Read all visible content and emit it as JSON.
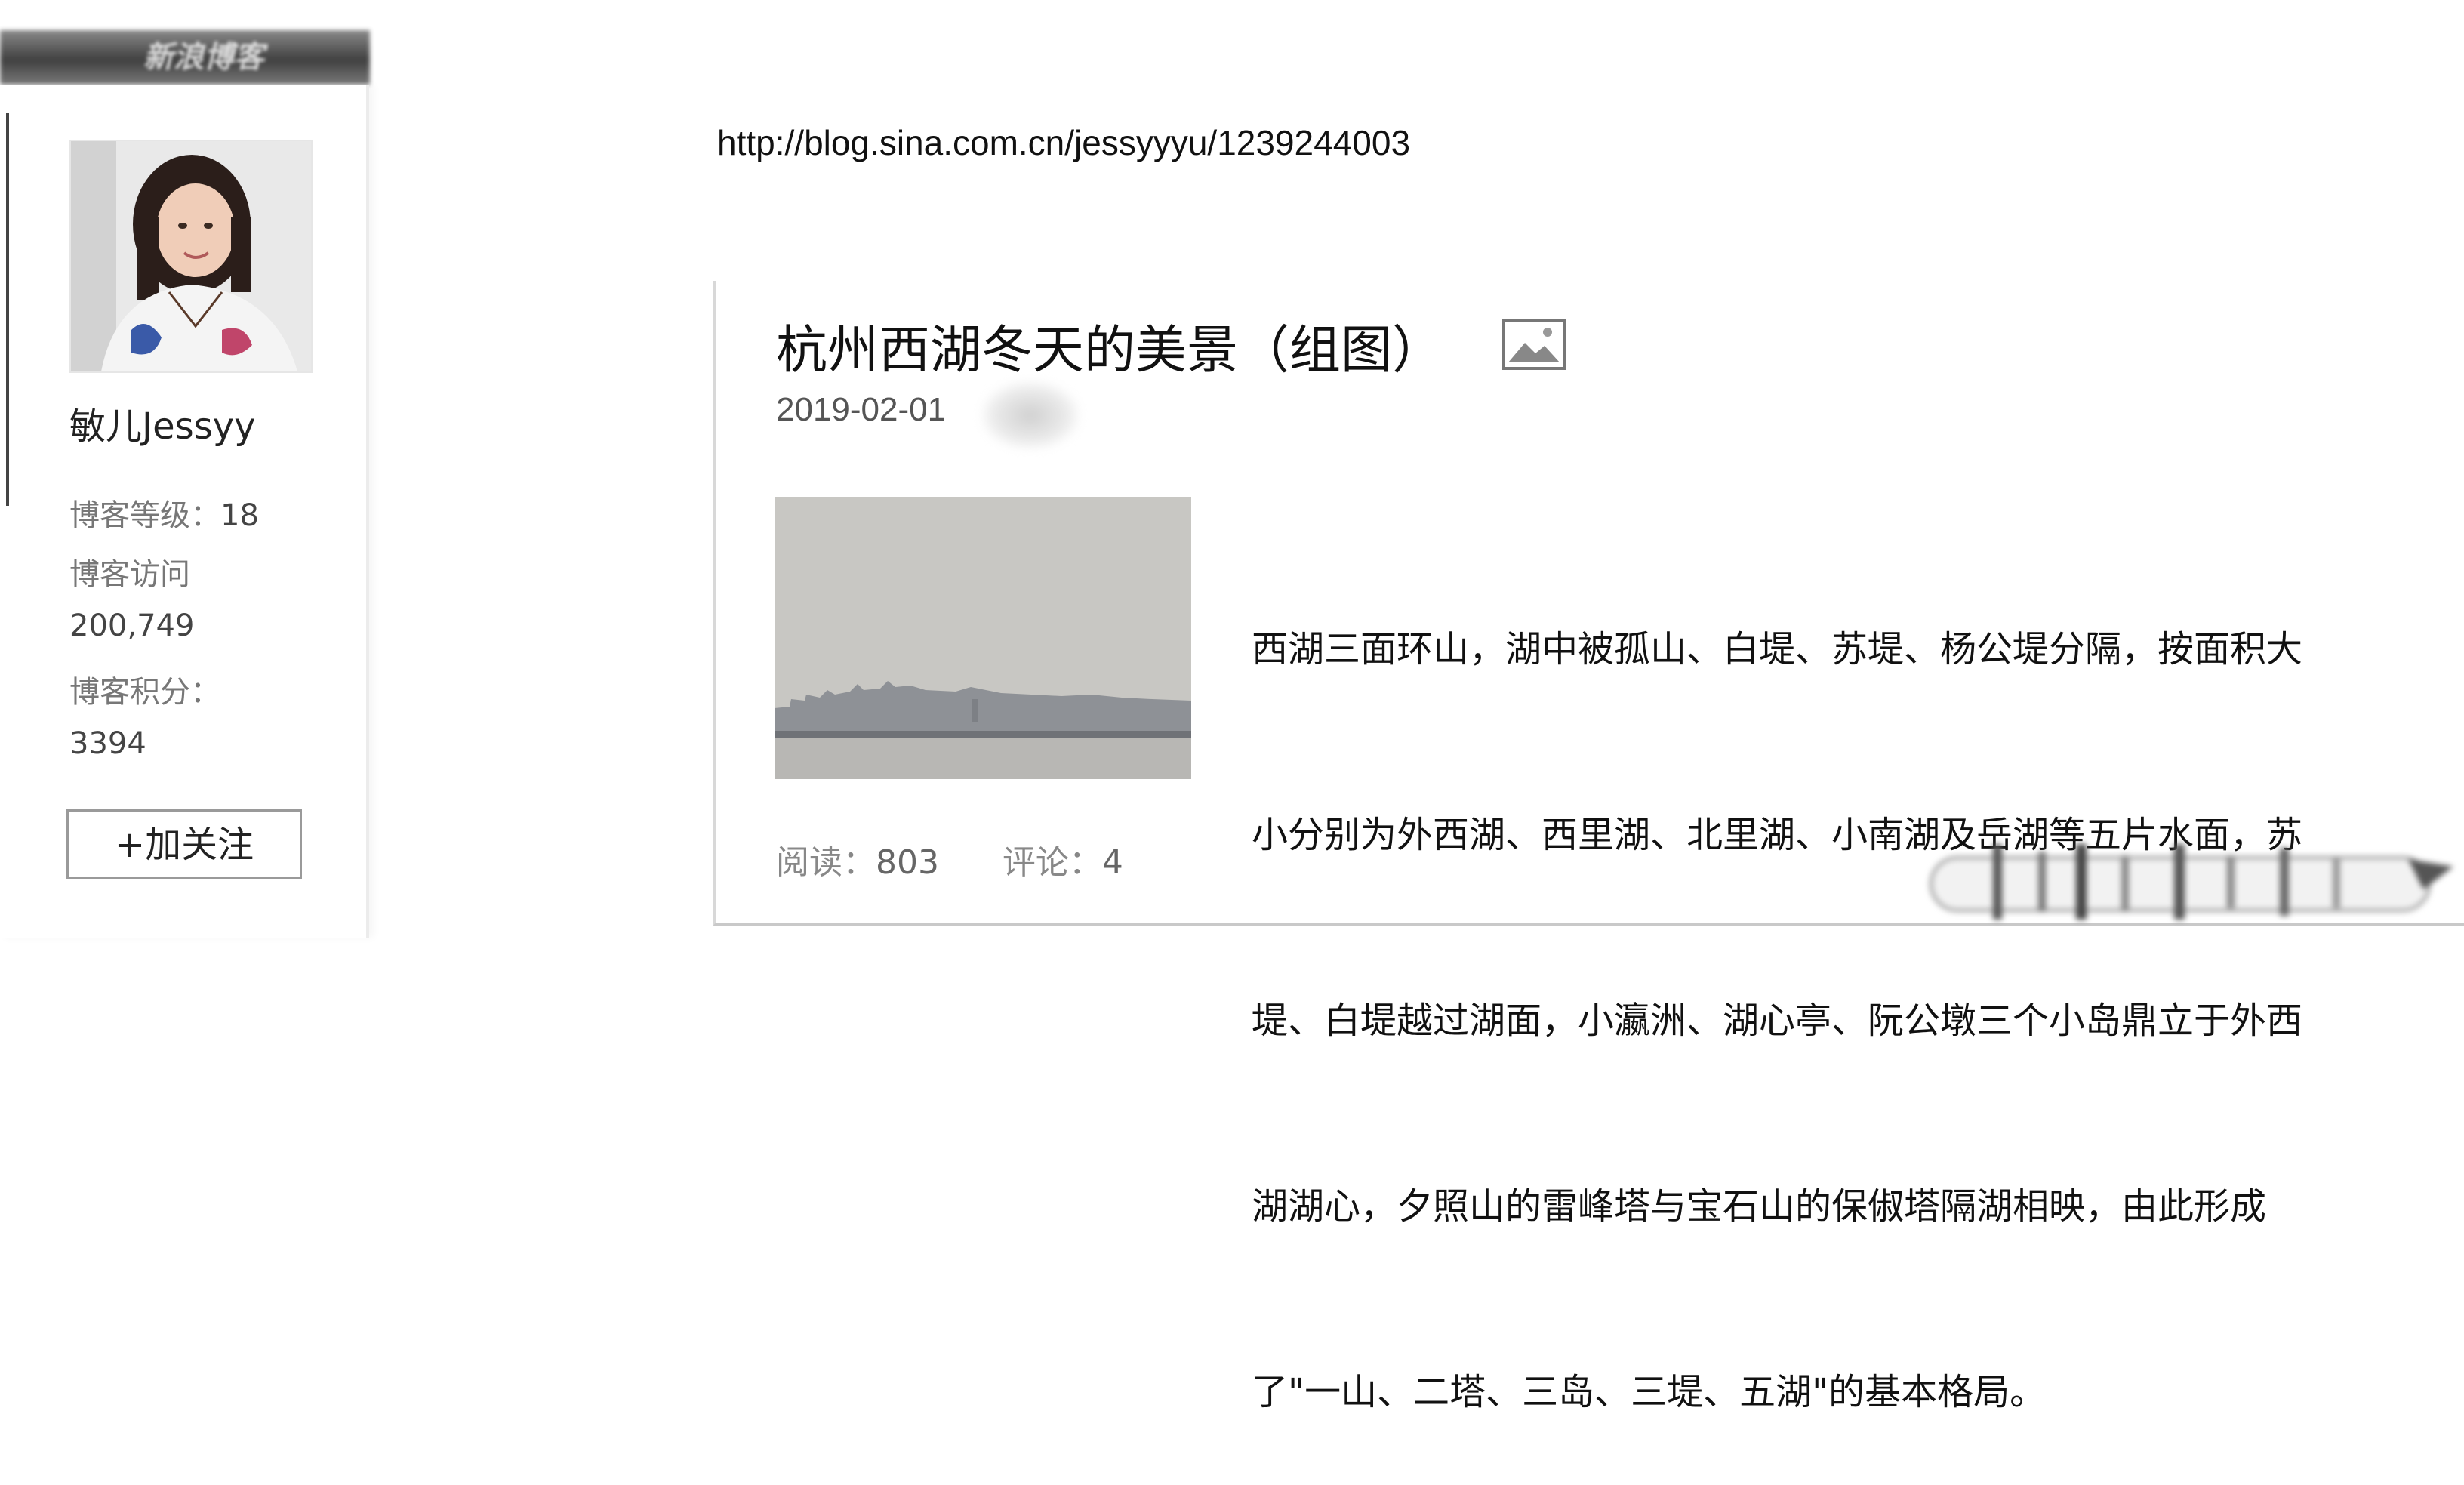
{
  "sidebar": {
    "header_text": "新浪博客",
    "profile": {
      "name": "敏儿Jessyy",
      "stats": {
        "level_label": "博客等级：",
        "level_value": "18",
        "visits_label": "博客访问",
        "visits_value": "200,749",
        "points_label": "博客积分：",
        "points_value": "3394"
      },
      "follow_button_label": "+加关注"
    }
  },
  "main": {
    "url": "http://blog.sina.com.cn/jessyyyu/1239244003",
    "post": {
      "title": "杭州西湖冬天的美景（组图）",
      "date": "2019-02-01",
      "excerpt_lines": [
        "西湖三面环山，湖中被孤山、白堤、苏堤、杨公堤分隔，按面积大",
        "小分别为外西湖、西里湖、北里湖、小南湖及岳湖等五片水面，苏",
        "堤、白堤越过湖面，小瀛洲、湖心亭、阮公墩三个小岛鼎立于外西",
        "湖湖心，夕照山的雷峰塔与宝石山的保俶塔隔湖相映，由此形成",
        "了\"一山、二塔、三岛、三堤、五湖\"的基本格局。"
      ],
      "reads_label": "阅读：",
      "reads_value": "803",
      "comments_label": "评论：",
      "comments_value": "4"
    }
  }
}
